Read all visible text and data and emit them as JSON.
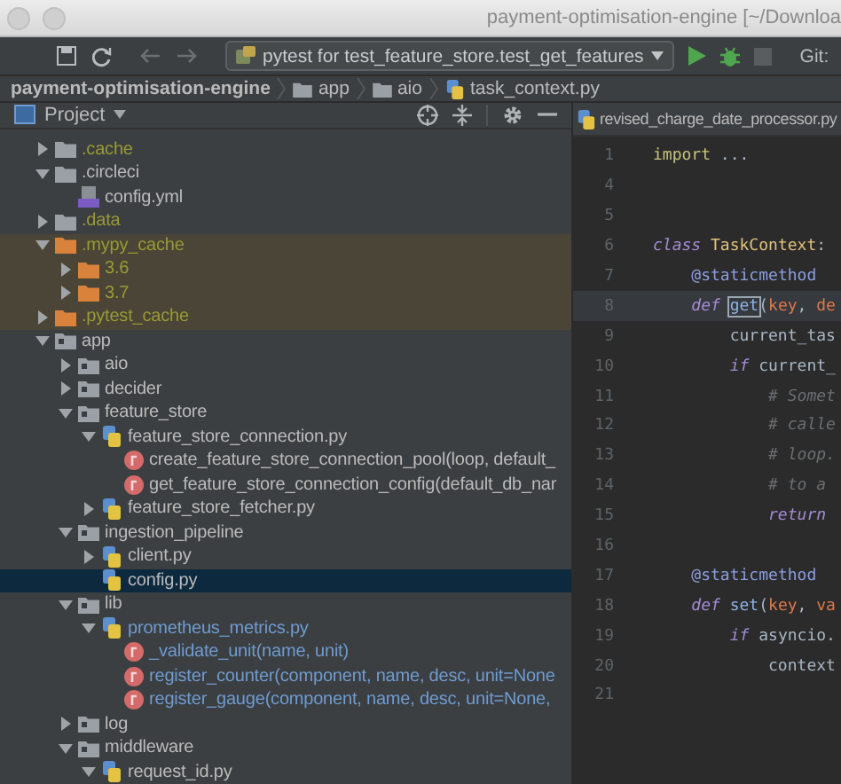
{
  "window": {
    "title": "payment-optimisation-engine [~/Downloa"
  },
  "toolbar": {
    "run_config": "pytest for test_feature_store.test_get_features",
    "git_label": "Git:"
  },
  "breadcrumbs": [
    {
      "label": "payment-optimisation-engine",
      "kind": "project"
    },
    {
      "label": "app",
      "kind": "folder"
    },
    {
      "label": "aio",
      "kind": "folder"
    },
    {
      "label": "task_context.py",
      "kind": "python"
    }
  ],
  "project_panel": {
    "title": "Project"
  },
  "tree": [
    {
      "label": ".cache",
      "kind": "folder",
      "ignored": true,
      "modified": false,
      "excluded": false,
      "selected": false,
      "expanded": false
    },
    {
      "label": ".circleci",
      "kind": "folder",
      "ignored": false,
      "modified": false,
      "excluded": false,
      "selected": false,
      "expanded": true,
      "children": [
        {
          "label": "config.yml",
          "kind": "yaml",
          "ignored": false,
          "modified": false,
          "excluded": false,
          "selected": false
        }
      ]
    },
    {
      "label": ".data",
      "kind": "folder",
      "ignored": true,
      "modified": false,
      "excluded": false,
      "selected": false,
      "expanded": false
    },
    {
      "label": ".mypy_cache",
      "kind": "folder",
      "ignored": true,
      "modified": false,
      "excluded": true,
      "selected": false,
      "expanded": true,
      "children": [
        {
          "label": "3.6",
          "kind": "folder",
          "ignored": true,
          "modified": false,
          "excluded": true,
          "selected": false,
          "expanded": false
        },
        {
          "label": "3.7",
          "kind": "folder",
          "ignored": true,
          "modified": false,
          "excluded": true,
          "selected": false,
          "expanded": false
        }
      ]
    },
    {
      "label": ".pytest_cache",
      "kind": "folder",
      "ignored": true,
      "modified": false,
      "excluded": true,
      "selected": false,
      "expanded": false
    },
    {
      "label": "app",
      "kind": "package",
      "ignored": false,
      "modified": false,
      "excluded": false,
      "selected": false,
      "expanded": true,
      "children": [
        {
          "label": "aio",
          "kind": "package",
          "ignored": false,
          "modified": false,
          "excluded": false,
          "selected": false,
          "expanded": false
        },
        {
          "label": "decider",
          "kind": "package",
          "ignored": false,
          "modified": false,
          "excluded": false,
          "selected": false,
          "expanded": false
        },
        {
          "label": "feature_store",
          "kind": "package",
          "ignored": false,
          "modified": false,
          "excluded": false,
          "selected": false,
          "expanded": true,
          "children": [
            {
              "label": "feature_store_connection.py",
              "kind": "python",
              "ignored": false,
              "modified": false,
              "excluded": false,
              "selected": false,
              "expanded": true,
              "children": [
                {
                  "label": "create_feature_store_connection_pool(loop, default_",
                  "kind": "function",
                  "ignored": false,
                  "modified": false,
                  "excluded": false,
                  "selected": false
                },
                {
                  "label": "get_feature_store_connection_config(default_db_nar",
                  "kind": "function",
                  "ignored": false,
                  "modified": false,
                  "excluded": false,
                  "selected": false
                }
              ]
            },
            {
              "label": "feature_store_fetcher.py",
              "kind": "python",
              "ignored": false,
              "modified": false,
              "excluded": false,
              "selected": false,
              "expanded": false
            }
          ]
        },
        {
          "label": "ingestion_pipeline",
          "kind": "package",
          "ignored": false,
          "modified": false,
          "excluded": false,
          "selected": false,
          "expanded": true,
          "children": [
            {
              "label": "client.py",
              "kind": "python",
              "ignored": false,
              "modified": false,
              "excluded": false,
              "selected": false,
              "expanded": false
            },
            {
              "label": "config.py",
              "kind": "python",
              "ignored": false,
              "modified": false,
              "excluded": false,
              "selected": true
            }
          ]
        },
        {
          "label": "lib",
          "kind": "package",
          "ignored": false,
          "modified": false,
          "excluded": false,
          "selected": false,
          "expanded": true,
          "children": [
            {
              "label": "prometheus_metrics.py",
              "kind": "python",
              "ignored": false,
              "modified": true,
              "excluded": false,
              "selected": false,
              "expanded": true,
              "children": [
                {
                  "label": "_validate_unit(name, unit)",
                  "kind": "function",
                  "ignored": false,
                  "modified": true,
                  "excluded": false,
                  "selected": false
                },
                {
                  "label": "register_counter(component, name, desc, unit=None",
                  "kind": "function",
                  "ignored": false,
                  "modified": true,
                  "excluded": false,
                  "selected": false
                },
                {
                  "label": "register_gauge(component, name, desc, unit=None,",
                  "kind": "function",
                  "ignored": false,
                  "modified": true,
                  "excluded": false,
                  "selected": false
                }
              ]
            }
          ]
        },
        {
          "label": "log",
          "kind": "package",
          "ignored": false,
          "modified": false,
          "excluded": false,
          "selected": false,
          "expanded": false
        },
        {
          "label": "middleware",
          "kind": "package",
          "ignored": false,
          "modified": false,
          "excluded": false,
          "selected": false,
          "expanded": true,
          "children": [
            {
              "label": "request_id.py",
              "kind": "python",
              "ignored": false,
              "modified": false,
              "excluded": false,
              "selected": false,
              "expanded": true
            }
          ]
        }
      ]
    }
  ],
  "editor": {
    "tab": "revised_charge_date_processor.py",
    "lines": [
      {
        "number": "1",
        "current": false,
        "tokens": [
          {
            "kind": "import",
            "text": "import"
          },
          {
            "kind": "plain",
            "text": " ..."
          }
        ]
      },
      {
        "number": "4",
        "current": false
      },
      {
        "number": "5",
        "current": false
      },
      {
        "number": "6",
        "current": false,
        "tokens": [
          {
            "kind": "keyword",
            "text": "class"
          },
          {
            "kind": "classname",
            "text": " TaskContext"
          },
          {
            "kind": "plain",
            "text": ":"
          }
        ]
      },
      {
        "number": "7",
        "current": false,
        "tokens": [
          {
            "kind": "indent"
          },
          {
            "kind": "decorator",
            "text": "@staticmethod"
          }
        ]
      },
      {
        "number": "8",
        "current": true,
        "tokens": [
          {
            "kind": "indent"
          },
          {
            "kind": "keyword",
            "text": "def"
          },
          {
            "kind": "space"
          },
          {
            "kind": "function",
            "text": "get",
            "matched": true
          },
          {
            "kind": "plain",
            "text": "("
          },
          {
            "kind": "param",
            "text": "key"
          },
          {
            "kind": "plain",
            "text": ","
          },
          {
            "kind": "space"
          },
          {
            "kind": "param",
            "text": "de"
          }
        ]
      },
      {
        "number": "9",
        "current": false,
        "tokens": [
          {
            "kind": "indent"
          },
          {
            "kind": "indent"
          },
          {
            "kind": "plain",
            "text": "current_tas"
          }
        ]
      },
      {
        "number": "10",
        "current": false,
        "tokens": [
          {
            "kind": "indent"
          },
          {
            "kind": "indent"
          },
          {
            "kind": "keyword",
            "text": "if"
          },
          {
            "kind": "plain",
            "text": " current_"
          }
        ]
      },
      {
        "number": "11",
        "current": false,
        "tokens": [
          {
            "kind": "indent"
          },
          {
            "kind": "indent"
          },
          {
            "kind": "indent"
          },
          {
            "kind": "comment",
            "text": "# Somet"
          }
        ]
      },
      {
        "number": "12",
        "current": false,
        "tokens": [
          {
            "kind": "indent"
          },
          {
            "kind": "indent"
          },
          {
            "kind": "indent"
          },
          {
            "kind": "comment",
            "text": "# calle"
          }
        ]
      },
      {
        "number": "13",
        "current": false,
        "tokens": [
          {
            "kind": "indent"
          },
          {
            "kind": "indent"
          },
          {
            "kind": "indent"
          },
          {
            "kind": "comment",
            "text": "# loop."
          }
        ]
      },
      {
        "number": "14",
        "current": false,
        "tokens": [
          {
            "kind": "indent"
          },
          {
            "kind": "indent"
          },
          {
            "kind": "indent"
          },
          {
            "kind": "comment",
            "text": "# to a"
          }
        ]
      },
      {
        "number": "15",
        "current": false,
        "tokens": [
          {
            "kind": "indent"
          },
          {
            "kind": "indent"
          },
          {
            "kind": "indent"
          },
          {
            "kind": "keyword",
            "text": "return"
          }
        ]
      },
      {
        "number": "16",
        "current": false
      },
      {
        "number": "17",
        "current": false,
        "tokens": [
          {
            "kind": "indent"
          },
          {
            "kind": "decorator",
            "text": "@staticmethod"
          }
        ]
      },
      {
        "number": "18",
        "current": false,
        "tokens": [
          {
            "kind": "indent"
          },
          {
            "kind": "keyword",
            "text": "def"
          },
          {
            "kind": "space"
          },
          {
            "kind": "function",
            "text": "set"
          },
          {
            "kind": "plain",
            "text": "("
          },
          {
            "kind": "param",
            "text": "key"
          },
          {
            "kind": "plain",
            "text": ","
          },
          {
            "kind": "space"
          },
          {
            "kind": "param",
            "text": "va"
          }
        ]
      },
      {
        "number": "19",
        "current": false,
        "tokens": [
          {
            "kind": "indent"
          },
          {
            "kind": "indent"
          },
          {
            "kind": "keyword",
            "text": "if"
          },
          {
            "kind": "plain",
            "text": " asyncio."
          }
        ]
      },
      {
        "number": "20",
        "current": false,
        "tokens": [
          {
            "kind": "indent"
          },
          {
            "kind": "indent"
          },
          {
            "kind": "indent"
          },
          {
            "kind": "plain",
            "text": "context"
          }
        ]
      },
      {
        "number": "21",
        "current": false
      }
    ]
  }
}
